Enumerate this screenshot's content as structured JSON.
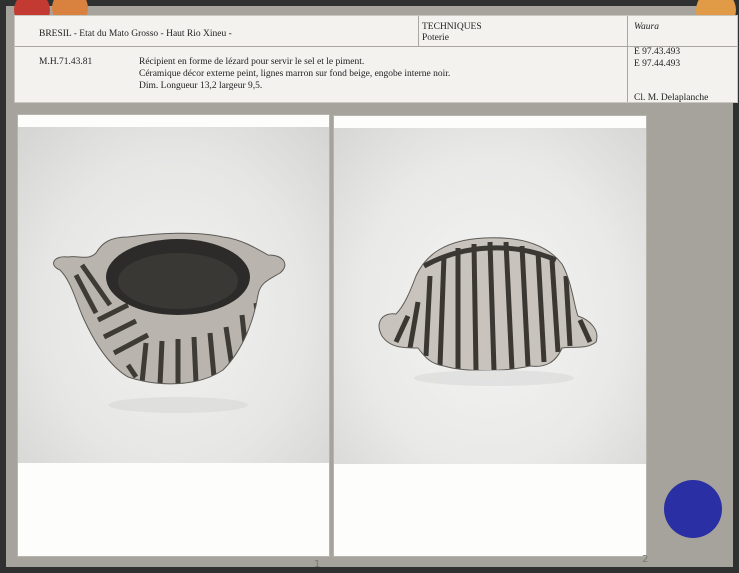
{
  "card": {
    "country_region": "BRESIL  -  Etat du Mato Grosso  -  Haut Rio Xineu  -",
    "techniques_title": "TECHNIQUES",
    "techniques_value": "Poterie",
    "culture": "Waura",
    "inventory_number": "M.H.71.43.81",
    "description_line1": "Récipient en forme de lézard pour servir le sel et le piment.",
    "description_line2": "Céramique décor externe peint, lignes marron sur fond beige, engobe interne noir.",
    "description_line3": "Dim. Longueur 13,2  largeur 9,5.",
    "negative_1": "E 97.43.493",
    "negative_2": "E 97.44.493",
    "photo_credit": "Cl. M. Delaplanche"
  },
  "photos": [
    {
      "pencil_mark": "1"
    },
    {
      "pencil_mark": "2"
    }
  ],
  "colors": {
    "dot_red": "#c23a32",
    "dot_orange": "#d9813f",
    "dot_blue": "#2b2fa4",
    "board": "#a6a29c"
  }
}
